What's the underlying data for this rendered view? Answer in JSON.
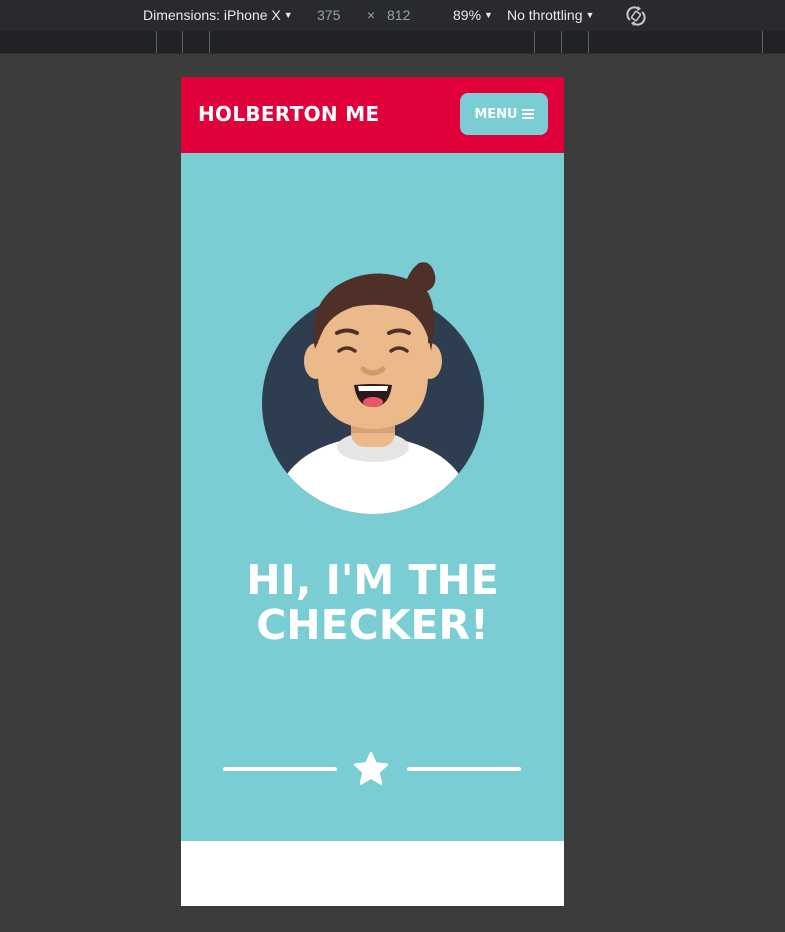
{
  "devtools": {
    "dimensions_label": "Dimensions: iPhone X",
    "width": "375",
    "times": "×",
    "height": "812",
    "zoom": "89%",
    "throttling": "No throttling",
    "caret": "▼",
    "rotate_icon": "rotate-icon"
  },
  "site": {
    "logo": "HOLBERTON ME",
    "menu_label": "MENU",
    "menu_icon": "bars-icon",
    "hero_line1": "HI, I'M THE",
    "hero_line2": "CHECKER!",
    "divider_icon": "star-icon",
    "colors": {
      "brand": "#e0003a",
      "accent": "#79cdd3",
      "avatar_bg": "#2e3d50",
      "hair": "#4e3028",
      "skin": "#ebb98a"
    }
  }
}
